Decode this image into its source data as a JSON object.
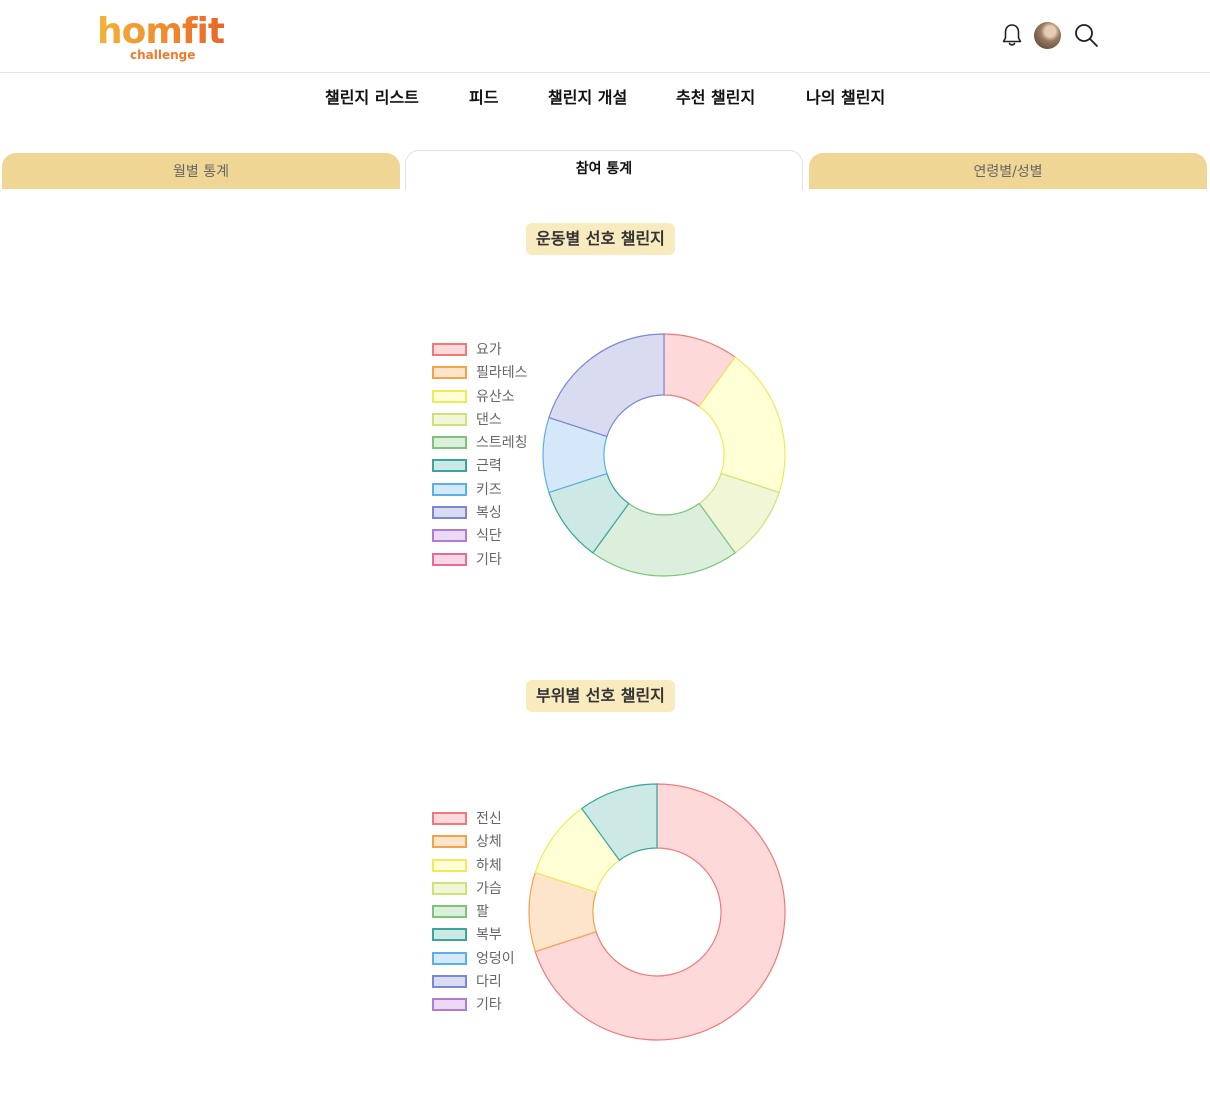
{
  "header": {
    "logo_main": "homfit",
    "logo_sub": "challenge",
    "icons": [
      "bell-icon",
      "avatar",
      "search-icon"
    ]
  },
  "nav": {
    "items": [
      "챌린지 리스트",
      "피드",
      "챌린지 개설",
      "추천 챌린지",
      "나의 챌린지"
    ]
  },
  "tabs": [
    {
      "label": "월별 통계",
      "active": false
    },
    {
      "label": "참여 통계",
      "active": true
    },
    {
      "label": "연령별/성별",
      "active": false
    }
  ],
  "sections": [
    {
      "title": "운동별 선호 챌린지"
    },
    {
      "title": "부위별 선호 챌린지"
    }
  ],
  "colors": {
    "brand_gold": "#efd695",
    "title_bg": "#f8ebbf",
    "palette_border": [
      "#f07a7a",
      "#f5a24a",
      "#f2e85a",
      "#cfe27a",
      "#7cc47a",
      "#3aa59a",
      "#5ab0e8",
      "#7a88d2",
      "#b07ad6",
      "#e86a9a"
    ],
    "palette_fill": [
      "#fdd9d9",
      "#fde5cc",
      "#ffffd6",
      "#f0f6d6",
      "#dcefdc",
      "#cce9e6",
      "#d4e8fa",
      "#d9dbf1",
      "#ebd9f5",
      "#fbd6e4"
    ]
  },
  "chart_data": [
    {
      "type": "pie",
      "variant": "doughnut",
      "title": "운동별 선호 챌린지",
      "legend_position": "left",
      "categories": [
        "요가",
        "필라테스",
        "유산소",
        "댄스",
        "스트레칭",
        "근력",
        "키즈",
        "복싱",
        "식단",
        "기타"
      ],
      "values": [
        1,
        0,
        2,
        1,
        2,
        1,
        1,
        2,
        0,
        0
      ]
    },
    {
      "type": "pie",
      "variant": "doughnut",
      "title": "부위별 선호 챌린지",
      "legend_position": "left",
      "categories": [
        "전신",
        "상체",
        "하체",
        "가슴",
        "팔",
        "복부",
        "엉덩이",
        "다리",
        "기타"
      ],
      "values": [
        7,
        1,
        1,
        0,
        0,
        1,
        0,
        0,
        0
      ]
    }
  ]
}
